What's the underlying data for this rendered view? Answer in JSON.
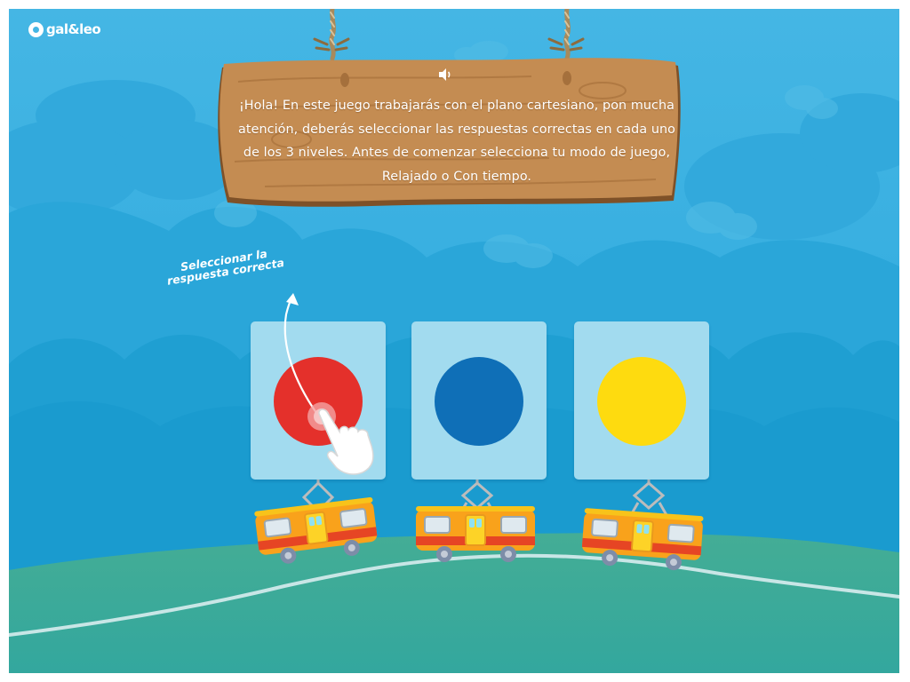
{
  "brand": {
    "logo_text": "gal&leo"
  },
  "sign": {
    "speaker_icon": "speaker-icon",
    "message": "¡Hola! En este juego trabajarás con el plano cartesiano, pon mucha atención, deberás seleccionar las respuestas correctas en cada uno de los 3 niveles. Antes de comenzar selecciona tu modo de juego, Relajado o Con tiempo."
  },
  "hint": {
    "line1": "Seleccionar la",
    "line2": "respuesta correcta"
  },
  "options": [
    {
      "color": "#e4302b"
    },
    {
      "color": "#0f6fb7"
    },
    {
      "color": "#fedb0f"
    }
  ],
  "colors": {
    "sky": "#45b6e4",
    "hill": "#3aa89e",
    "wood": "#c28a4f",
    "card": "#a2dbef"
  }
}
